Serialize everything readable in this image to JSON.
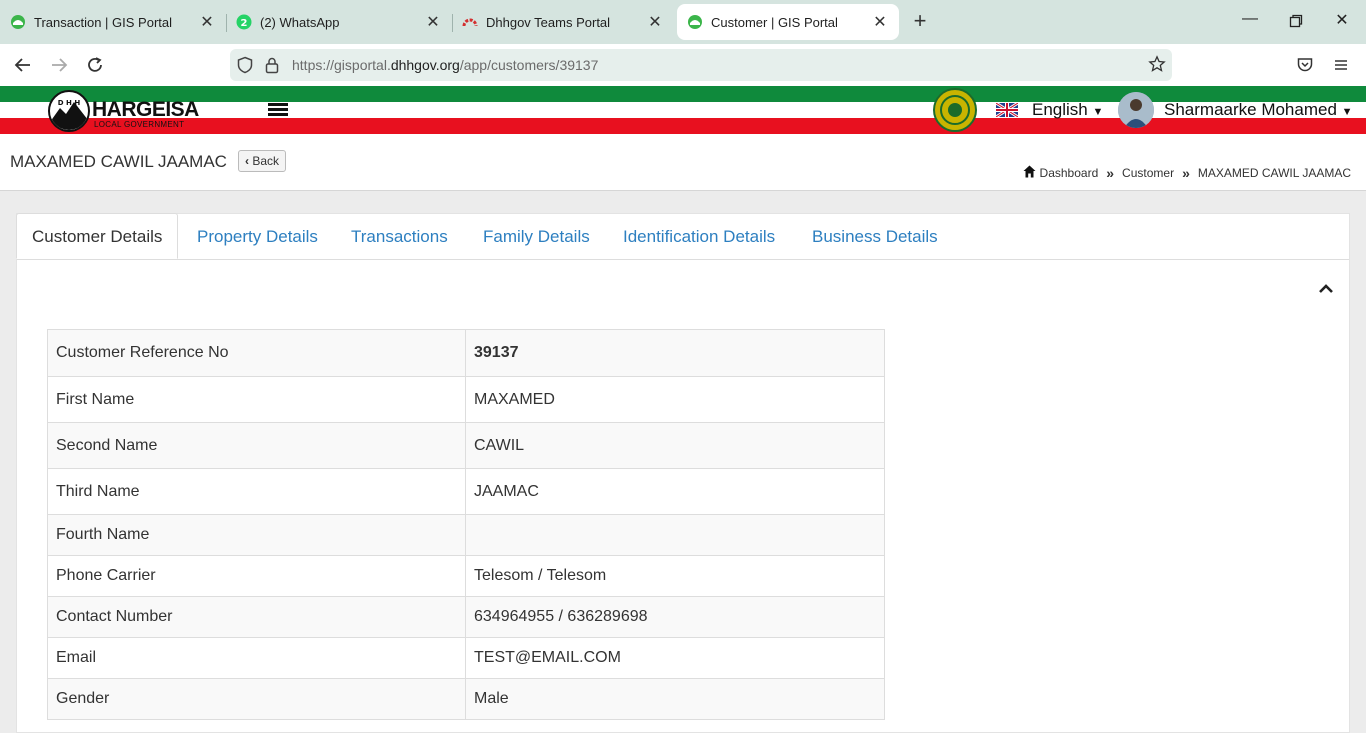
{
  "browser": {
    "tabs": [
      {
        "title": "Transaction | GIS Portal",
        "active": false
      },
      {
        "title": "(2) WhatsApp",
        "active": false,
        "badge": "2"
      },
      {
        "title": "Dhhgov Teams Portal",
        "active": false
      },
      {
        "title": "Customer | GIS Portal",
        "active": true
      }
    ],
    "url_prefix": "https://gisportal.",
    "url_domain": "dhhgov.org",
    "url_path": "/app/customers/39137"
  },
  "header": {
    "logo_text": "HARGEISA",
    "logo_sub": "LOCAL GOVERNMENT",
    "logo_initials": "D H H",
    "language": "English",
    "user_name": "Sharmaarke Mohamed"
  },
  "page": {
    "title": "MAXAMED CAWIL JAAMAC",
    "back_label": "Back",
    "breadcrumb": [
      "Dashboard",
      "Customer",
      "MAXAMED CAWIL JAAMAC"
    ]
  },
  "tabs": [
    {
      "label": "Customer Details",
      "active": true
    },
    {
      "label": "Property Details",
      "active": false
    },
    {
      "label": "Transactions",
      "active": false
    },
    {
      "label": "Family Details",
      "active": false
    },
    {
      "label": "Identification Details",
      "active": false
    },
    {
      "label": "Business Details",
      "active": false
    }
  ],
  "details": [
    {
      "label": "Customer Reference No",
      "value": "39137"
    },
    {
      "label": "First Name",
      "value": "MAXAMED"
    },
    {
      "label": "Second Name",
      "value": "CAWIL"
    },
    {
      "label": "Third Name",
      "value": "JAAMAC"
    },
    {
      "label": "Fourth Name",
      "value": ""
    },
    {
      "label": "Phone Carrier",
      "value": "Telesom / Telesom"
    },
    {
      "label": "Contact Number",
      "value": "634964955 / 636289698"
    },
    {
      "label": "Email",
      "value": "TEST@EMAIL.COM"
    },
    {
      "label": "Gender",
      "value": "Male"
    }
  ],
  "colors": {
    "link": "#2d7fc0",
    "flag_green": "#0f8a3c",
    "flag_red": "#e8101f",
    "browser_chrome": "#d5e4df"
  }
}
